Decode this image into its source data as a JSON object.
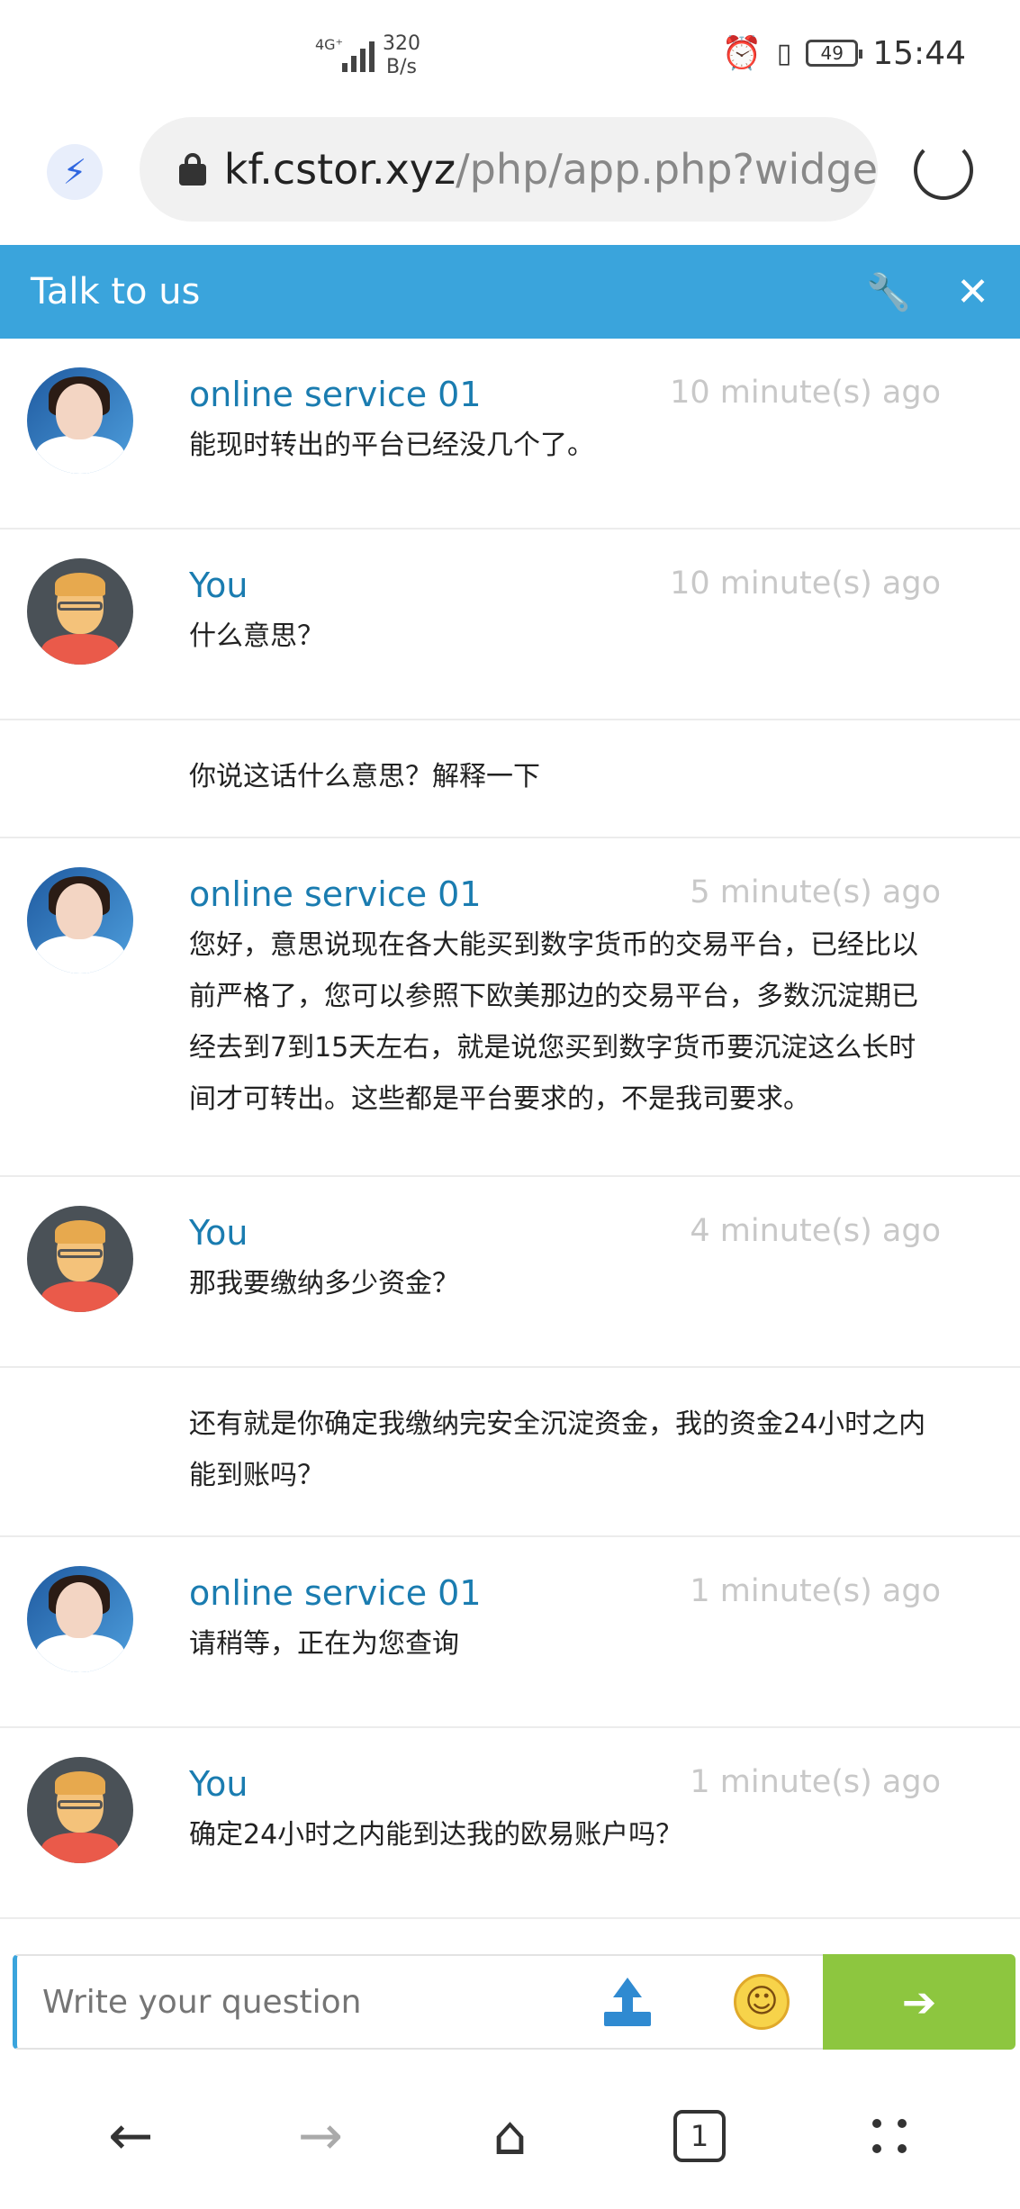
{
  "status_bar": {
    "network": "4G⁺",
    "speed_value": "320",
    "speed_unit": "B/s",
    "battery": "49",
    "time": "15:44"
  },
  "address_bar": {
    "host": "kf.cstor.xyz",
    "path": "/php/app.php?widge"
  },
  "chat_header": {
    "title": "Talk to us",
    "wrench_icon": "wrench-icon",
    "close_icon": "close-icon"
  },
  "messages": [
    {
      "sender": "online service 01",
      "time": "10 minute(s) ago",
      "text": "能现时转出的平台已经没几个了。"
    },
    {
      "sender": "You",
      "time": "10 minute(s) ago",
      "text": "什么意思？"
    },
    {
      "text": "你说这话什么意思？解释一下"
    },
    {
      "sender": "online service 01",
      "time": "5 minute(s) ago",
      "text": "您好，意思说现在各大能买到数字货币的交易平台，已经比以前严格了，您可以参照下欧美那边的交易平台，多数沉淀期已经去到7到15天左右，就是说您买到数字货币要沉淀这么长时间才可转出。这些都是平台要求的，不是我司要求。"
    },
    {
      "sender": "You",
      "time": "4 minute(s) ago",
      "text": "那我要缴纳多少资金？"
    },
    {
      "text": "还有就是你确定我缴纳完安全沉淀资金，我的资金24小时之内能到账吗？"
    },
    {
      "sender": "online service 01",
      "time": "1 minute(s) ago",
      "text": "请稍等，正在为您查询"
    },
    {
      "sender": "You",
      "time": "1 minute(s) ago",
      "text": "确定24小时之内能到达我的欧易账户吗？"
    }
  ],
  "composer": {
    "placeholder": "Write your question",
    "upload_icon": "upload-icon",
    "emoji_icon": "smiley-icon",
    "send_icon": "arrow-right-icon"
  },
  "nav": {
    "tab_count": "1"
  }
}
